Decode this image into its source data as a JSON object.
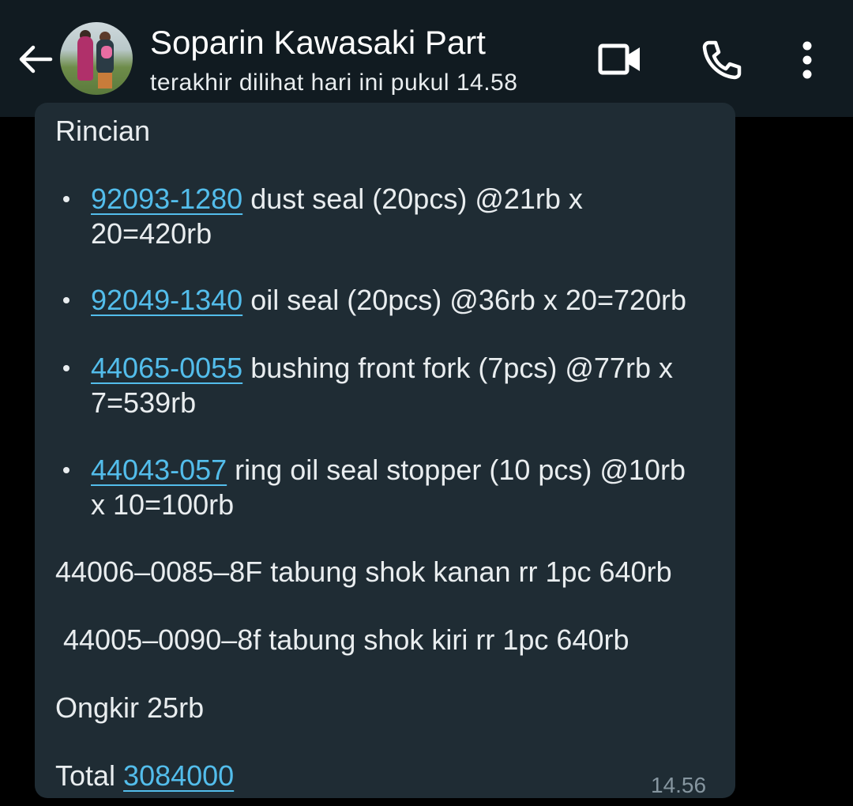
{
  "header": {
    "contact_name": "Soparin Kawasaki Part",
    "last_seen": "terakhir dilihat hari ini pukul 14.58",
    "icons": [
      "back-arrow-icon",
      "video-call-icon",
      "phone-icon",
      "more-options-icon"
    ]
  },
  "message": {
    "heading": "Rincian",
    "items": [
      {
        "code": "92093-1280",
        "text": " dust seal (20pcs) @21rb x",
        "text2": "20=420rb"
      },
      {
        "code": "92049-1340",
        "text": " oil seal (20pcs) @36rb x 20=720rb",
        "text2": ""
      },
      {
        "code": "44065-0055",
        "text": " bushing front fork (7pcs) @77rb x",
        "text2": "7=539rb"
      },
      {
        "code": "44043-057",
        "text": " ring oil seal stopper (10 pcs) @10rb",
        "text2": "x 10=100rb"
      }
    ],
    "line1": "44006–0085–8F tabung shok kanan rr 1pc 640rb",
    "line2": " 44005–0090–8f tabung shok kiri rr 1pc 640rb",
    "shipping": "Ongkir 25rb",
    "total_label": "Total ",
    "total_value": "3084000",
    "time": "14.56"
  },
  "colors": {
    "header_bg": "#111b21",
    "bubble_bg": "#1f2c34",
    "link": "#53bdeb",
    "timestamp": "#8696a0"
  }
}
